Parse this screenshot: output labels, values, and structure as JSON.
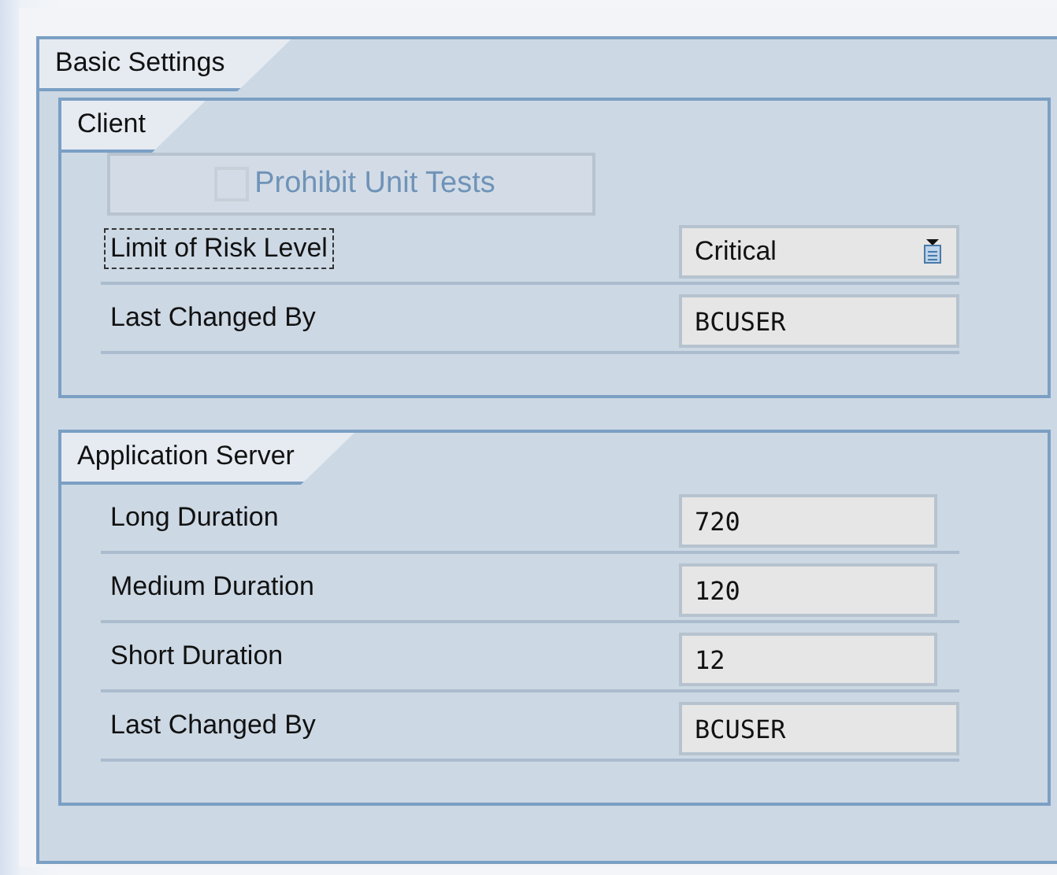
{
  "group": {
    "title": "Basic Settings",
    "sections": [
      {
        "title": "Client",
        "rows": [
          {
            "kind": "checkbox",
            "label": "Prohibit Unit Tests",
            "checked": false,
            "disabled": true
          },
          {
            "kind": "dropdown",
            "label": "Limit of Risk Level",
            "focused": true,
            "value": "Critical"
          },
          {
            "kind": "text",
            "label": "Last Changed By",
            "focused": false,
            "value": "BCUSER"
          }
        ]
      },
      {
        "title": "Application Server",
        "rows": [
          {
            "kind": "number",
            "label": "Long Duration",
            "focused": false,
            "value": "720"
          },
          {
            "kind": "number",
            "label": "Medium Duration",
            "focused": false,
            "value": "120"
          },
          {
            "kind": "number",
            "label": "Short Duration",
            "focused": false,
            "value": "12"
          },
          {
            "kind": "text",
            "label": "Last Changed By",
            "focused": false,
            "value": "BCUSER"
          }
        ]
      }
    ]
  }
}
